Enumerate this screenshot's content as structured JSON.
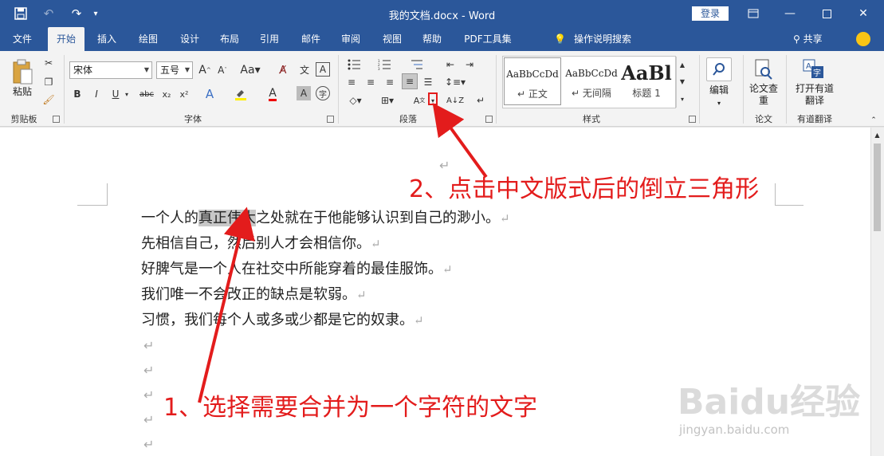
{
  "titlebar": {
    "document_title": "我的文档.docx  -  Word",
    "login_label": "登录",
    "quick_access": [
      {
        "icon": "save-icon"
      },
      {
        "icon": "undo-icon"
      },
      {
        "icon": "redo-icon"
      },
      {
        "icon": "customize-qa-icon"
      }
    ],
    "window_buttons": [
      {
        "icon": "ribbon-display-icon"
      },
      {
        "icon": "minimize-icon"
      },
      {
        "icon": "maximize-icon"
      },
      {
        "icon": "close-icon"
      }
    ]
  },
  "tabs": [
    "文件",
    "开始",
    "插入",
    "绘图",
    "设计",
    "布局",
    "引用",
    "邮件",
    "审阅",
    "视图",
    "帮助",
    "PDF工具集"
  ],
  "active_tab": "开始",
  "tell_me": "操作说明搜索",
  "share_label": "共享",
  "ribbon": {
    "clipboard": {
      "label": "剪贴板",
      "paste_label": "粘贴"
    },
    "font": {
      "label": "字体",
      "font_name": "宋体",
      "font_size": "五号",
      "buttons": [
        "B",
        "I",
        "U",
        "abc",
        "x₂",
        "x²",
        "A",
        "A"
      ]
    },
    "paragraph": {
      "label": "段落"
    },
    "styles": {
      "label": "样式",
      "items": [
        {
          "sample": "AaBbCcDd",
          "name": "正文"
        },
        {
          "sample": "AaBbCcDd",
          "name": "无间隔"
        },
        {
          "sample": "AaBl",
          "name": "标题 1"
        }
      ]
    },
    "editing": {
      "label": "编辑"
    },
    "paper": {
      "button": "论文查重",
      "label": "论文"
    },
    "translate": {
      "button": "打开有道翻译",
      "label": "有道翻译"
    }
  },
  "document": {
    "lines": [
      {
        "before": "一个人的",
        "highlight": "真正伟大",
        "after": "之处就在于他能够认识到自己的渺小。"
      },
      {
        "before": "先相信自己，然后别人才会相信你。",
        "highlight": "",
        "after": ""
      },
      {
        "before": "好脾气是一个人在社交中所能穿着的最佳服饰。",
        "highlight": "",
        "after": ""
      },
      {
        "before": "我们唯一不会改正的缺点是软弱。",
        "highlight": "",
        "after": ""
      },
      {
        "before": "习惯，我们每个人或多或少都是它的奴隶。",
        "highlight": "",
        "after": ""
      }
    ],
    "para_mark": "↵"
  },
  "annotations": {
    "step2": "2、点击中文版式后的倒立三角形",
    "step1": "1、选择需要合并为一个字符的文字",
    "color": "#e31c1c"
  },
  "watermark": {
    "main": "Baidu经验",
    "sub": "jingyan.baidu.com"
  }
}
